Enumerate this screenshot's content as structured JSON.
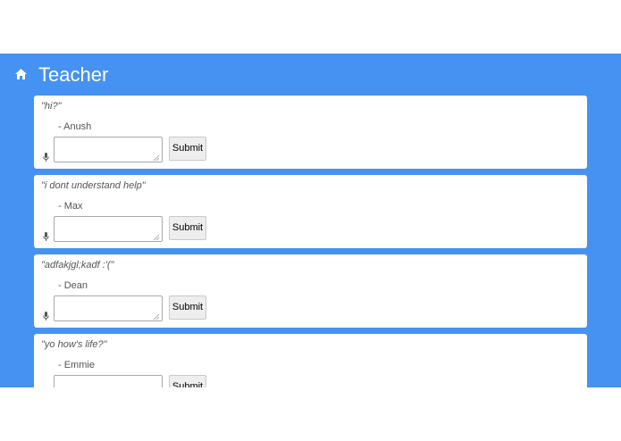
{
  "header": {
    "title": "Teacher",
    "home_icon": "home-icon"
  },
  "colors": {
    "background": "#4592f2",
    "card": "#ffffff",
    "text_muted": "#555555"
  },
  "questions": [
    {
      "quote": "\"hi?\"",
      "author": "- Anush",
      "reply_value": "",
      "submit_label": "Submit"
    },
    {
      "quote": "\"i dont understand help\"",
      "author": "- Max",
      "reply_value": "",
      "submit_label": "Submit"
    },
    {
      "quote": "\"adfakjgl;kadf :'(\"",
      "author": "- Dean",
      "reply_value": "",
      "submit_label": "Submit"
    },
    {
      "quote": "\"yo how's life?\"",
      "author": "- Emmie",
      "reply_value": "",
      "submit_label": "Submit"
    }
  ]
}
